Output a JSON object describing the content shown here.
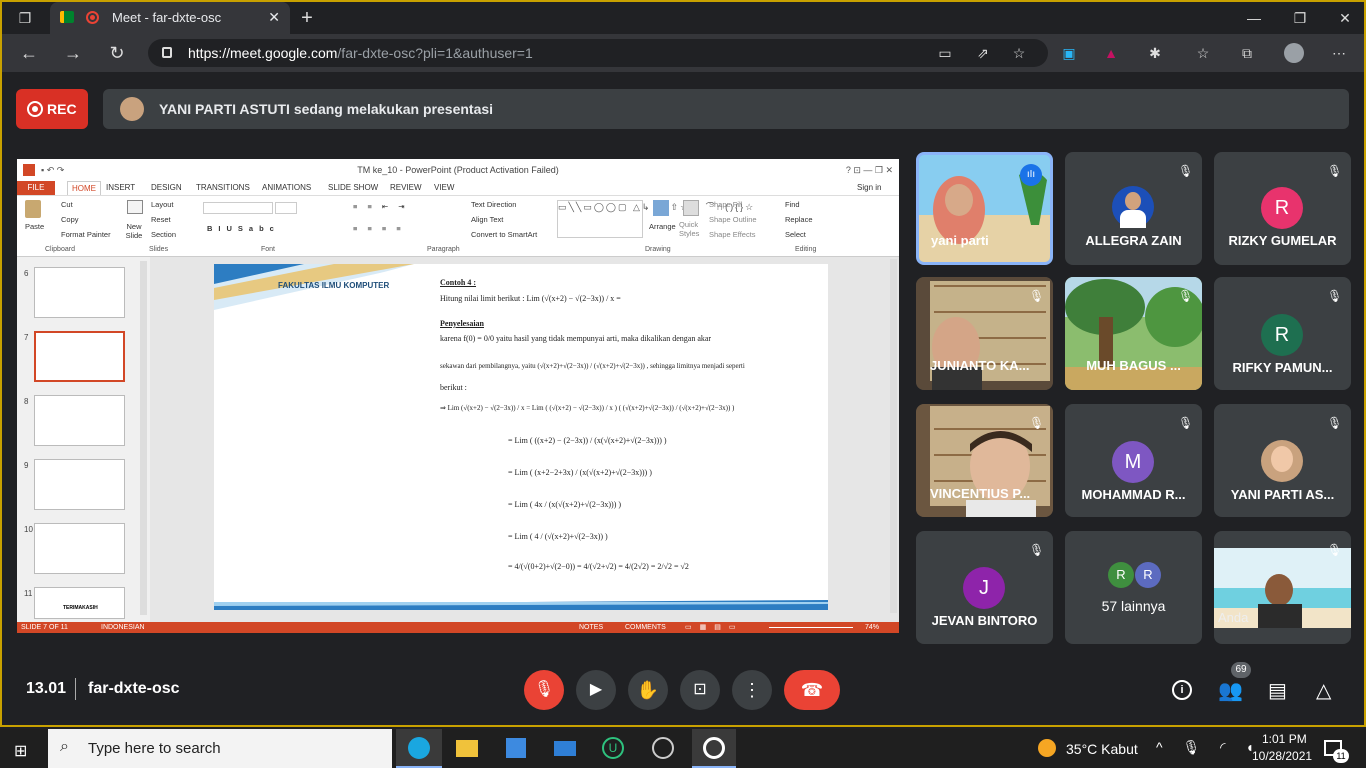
{
  "browser": {
    "tab_title": "Meet - far-dxte-osc",
    "url_host": "https://meet.google.com",
    "url_path": "/far-dxte-osc?pli=1&authuser=1"
  },
  "meet": {
    "rec_label": "REC",
    "presenting_text": "YANI PARTI ASTUTI sedang melakukan presentasi",
    "time": "13.01",
    "meeting_code": "far-dxte-osc",
    "participant_count": "69"
  },
  "ppt": {
    "window_title": "TM ke_10 - PowerPoint (Product Activation Failed)",
    "sign_in": "Sign in",
    "tabs": [
      "FILE",
      "HOME",
      "INSERT",
      "DESIGN",
      "TRANSITIONS",
      "ANIMATIONS",
      "SLIDE SHOW",
      "REVIEW",
      "VIEW"
    ],
    "ribbon": {
      "paste": "Paste",
      "cut": "Cut",
      "copy": "Copy",
      "format_painter": "Format Painter",
      "new_slide": "New Slide",
      "layout": "Layout",
      "reset": "Reset",
      "section": "Section",
      "text_direction": "Text Direction",
      "align_text": "Align Text",
      "convert_smartart": "Convert to SmartArt",
      "arrange": "Arrange",
      "quick_styles": "Quick Styles",
      "shape_fill": "Shape Fill",
      "shape_outline": "Shape Outline",
      "shape_effects": "Shape Effects",
      "find": "Find",
      "replace": "Replace",
      "select": "Select",
      "groups": [
        "Clipboard",
        "Slides",
        "Font",
        "Paragraph",
        "Drawing",
        "Editing"
      ]
    },
    "thumbs": [
      "6",
      "7",
      "8",
      "9",
      "10",
      "11"
    ],
    "thumb11_text": "TERIMAKASIH",
    "status": {
      "slide": "SLIDE 7 OF 11",
      "language": "INDONESIAN",
      "notes": "NOTES",
      "comments": "COMMENTS",
      "zoom": "74%"
    },
    "slide": {
      "header": "FAKULTAS ILMU KOMPUTER",
      "heading": "Contoh 4 :",
      "q": "Hitung nilai limit berikut : Lim (√(x+2) − √(2−3x)) / x =",
      "solution": "Penyelesaian",
      "line1": "karena  f(0) = 0/0  yaitu hasil yang tidak mempunyai arti, maka dikalikan dengan akar",
      "line2": "sekawan dari pembilangnya, yaitu  (√(x+2)+√(2−3x)) / (√(x+2)+√(2−3x)) , sehingga limitnya menjadi seperti",
      "line3": "berikut :",
      "s1": "⇒ Lim (√(x+2) − √(2−3x)) / x    = Lim ( (√(x+2) − √(2−3x)) / x ) ( (√(x+2)+√(2−3x)) / (√(x+2)+√(2−3x)) )",
      "s2": "= Lim ( ((x+2) − (2−3x)) / (x(√(x+2)+√(2−3x))) )",
      "s3": "= Lim ( (x+2−2+3x) / (x(√(x+2)+√(2−3x))) )",
      "s4": "= Lim ( 4x / (x(√(x+2)+√(2−3x))) )",
      "s5": "= Lim ( 4 / (√(x+2)+√(2−3x)) )",
      "s6": "= 4/(√(0+2)+√(2−0))  =  4/(√2+√2)  =  4/(2√2)  =  2/√2  = √2"
    }
  },
  "participants": [
    {
      "name": "yani parti",
      "type": "video"
    },
    {
      "name": "ALLEGRA ZAIN",
      "type": "photo"
    },
    {
      "name": "RIZKY GUMELAR",
      "initial": "R",
      "color": "#e8336d"
    },
    {
      "name": "JUNIANTO KA...",
      "type": "video"
    },
    {
      "name": "MUH BAGUS ...",
      "type": "video"
    },
    {
      "name": "RIFKY PAMUN...",
      "initial": "R",
      "color": "#1e6f50"
    },
    {
      "name": "VINCENTIUS P...",
      "type": "video"
    },
    {
      "name": "MOHAMMAD R...",
      "initial": "M",
      "color": "#7e57c2"
    },
    {
      "name": "YANI PARTI AS...",
      "type": "photo"
    },
    {
      "name": "JEVAN BINTORO",
      "initial": "J",
      "color": "#8e24aa"
    },
    {
      "name": "57 lainnya",
      "initials": [
        "R",
        "R"
      ]
    },
    {
      "name": "Anda",
      "type": "video"
    }
  ],
  "taskbar": {
    "search_placeholder": "Type here to search",
    "weather": "35°C  Kabut",
    "clock_time": "1:01 PM",
    "clock_date": "10/28/2021",
    "notif_count": "11"
  }
}
